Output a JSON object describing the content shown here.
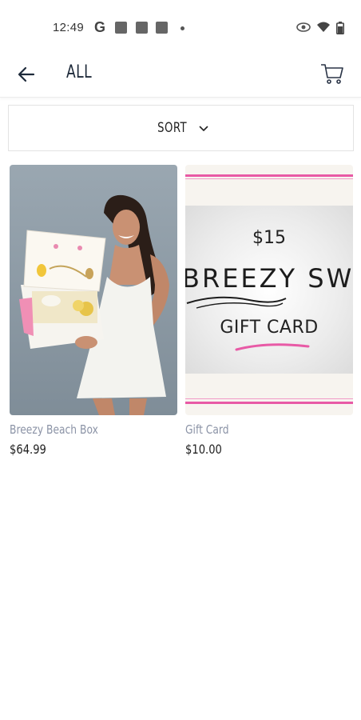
{
  "status_bar": {
    "time": "12:49",
    "notification_letter": "G",
    "icons": [
      "google-icon",
      "notification-square-icon",
      "notification-square-icon",
      "notification-square-icon",
      "dot-icon",
      "eye-icon",
      "wifi-icon",
      "battery-icon"
    ]
  },
  "app_bar": {
    "title": "ALL",
    "back_icon": "arrow-left-icon",
    "cart_icon": "cart-icon"
  },
  "sort": {
    "label": "SORT",
    "icon": "chevron-down-icon"
  },
  "products": [
    {
      "name": "Breezy Beach Box",
      "price": "$64.99",
      "image": "woman-holding-gift-box-photo"
    },
    {
      "name": "Gift Card",
      "price": "$10.00",
      "image": {
        "amount": "$15",
        "brand": "BREEZY SWI",
        "label": "GIFT CARD"
      }
    }
  ],
  "colors": {
    "title_text": "#1e2a3a",
    "product_name": "#8b93a6",
    "gift_card_accent": "#e85aa6"
  }
}
